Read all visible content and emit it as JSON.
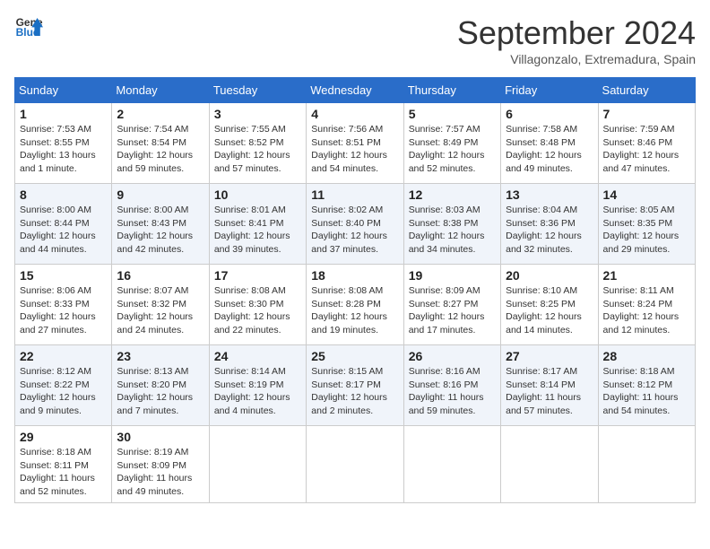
{
  "logo": {
    "line1": "General",
    "line2": "Blue"
  },
  "title": "September 2024",
  "location": "Villagonzalo, Extremadura, Spain",
  "headers": [
    "Sunday",
    "Monday",
    "Tuesday",
    "Wednesday",
    "Thursday",
    "Friday",
    "Saturday"
  ],
  "weeks": [
    [
      {
        "day": "1",
        "sunrise": "7:53 AM",
        "sunset": "8:55 PM",
        "daylight": "13 hours and 1 minute."
      },
      {
        "day": "2",
        "sunrise": "7:54 AM",
        "sunset": "8:54 PM",
        "daylight": "12 hours and 59 minutes."
      },
      {
        "day": "3",
        "sunrise": "7:55 AM",
        "sunset": "8:52 PM",
        "daylight": "12 hours and 57 minutes."
      },
      {
        "day": "4",
        "sunrise": "7:56 AM",
        "sunset": "8:51 PM",
        "daylight": "12 hours and 54 minutes."
      },
      {
        "day": "5",
        "sunrise": "7:57 AM",
        "sunset": "8:49 PM",
        "daylight": "12 hours and 52 minutes."
      },
      {
        "day": "6",
        "sunrise": "7:58 AM",
        "sunset": "8:48 PM",
        "daylight": "12 hours and 49 minutes."
      },
      {
        "day": "7",
        "sunrise": "7:59 AM",
        "sunset": "8:46 PM",
        "daylight": "12 hours and 47 minutes."
      }
    ],
    [
      {
        "day": "8",
        "sunrise": "8:00 AM",
        "sunset": "8:44 PM",
        "daylight": "12 hours and 44 minutes."
      },
      {
        "day": "9",
        "sunrise": "8:00 AM",
        "sunset": "8:43 PM",
        "daylight": "12 hours and 42 minutes."
      },
      {
        "day": "10",
        "sunrise": "8:01 AM",
        "sunset": "8:41 PM",
        "daylight": "12 hours and 39 minutes."
      },
      {
        "day": "11",
        "sunrise": "8:02 AM",
        "sunset": "8:40 PM",
        "daylight": "12 hours and 37 minutes."
      },
      {
        "day": "12",
        "sunrise": "8:03 AM",
        "sunset": "8:38 PM",
        "daylight": "12 hours and 34 minutes."
      },
      {
        "day": "13",
        "sunrise": "8:04 AM",
        "sunset": "8:36 PM",
        "daylight": "12 hours and 32 minutes."
      },
      {
        "day": "14",
        "sunrise": "8:05 AM",
        "sunset": "8:35 PM",
        "daylight": "12 hours and 29 minutes."
      }
    ],
    [
      {
        "day": "15",
        "sunrise": "8:06 AM",
        "sunset": "8:33 PM",
        "daylight": "12 hours and 27 minutes."
      },
      {
        "day": "16",
        "sunrise": "8:07 AM",
        "sunset": "8:32 PM",
        "daylight": "12 hours and 24 minutes."
      },
      {
        "day": "17",
        "sunrise": "8:08 AM",
        "sunset": "8:30 PM",
        "daylight": "12 hours and 22 minutes."
      },
      {
        "day": "18",
        "sunrise": "8:08 AM",
        "sunset": "8:28 PM",
        "daylight": "12 hours and 19 minutes."
      },
      {
        "day": "19",
        "sunrise": "8:09 AM",
        "sunset": "8:27 PM",
        "daylight": "12 hours and 17 minutes."
      },
      {
        "day": "20",
        "sunrise": "8:10 AM",
        "sunset": "8:25 PM",
        "daylight": "12 hours and 14 minutes."
      },
      {
        "day": "21",
        "sunrise": "8:11 AM",
        "sunset": "8:24 PM",
        "daylight": "12 hours and 12 minutes."
      }
    ],
    [
      {
        "day": "22",
        "sunrise": "8:12 AM",
        "sunset": "8:22 PM",
        "daylight": "12 hours and 9 minutes."
      },
      {
        "day": "23",
        "sunrise": "8:13 AM",
        "sunset": "8:20 PM",
        "daylight": "12 hours and 7 minutes."
      },
      {
        "day": "24",
        "sunrise": "8:14 AM",
        "sunset": "8:19 PM",
        "daylight": "12 hours and 4 minutes."
      },
      {
        "day": "25",
        "sunrise": "8:15 AM",
        "sunset": "8:17 PM",
        "daylight": "12 hours and 2 minutes."
      },
      {
        "day": "26",
        "sunrise": "8:16 AM",
        "sunset": "8:16 PM",
        "daylight": "11 hours and 59 minutes."
      },
      {
        "day": "27",
        "sunrise": "8:17 AM",
        "sunset": "8:14 PM",
        "daylight": "11 hours and 57 minutes."
      },
      {
        "day": "28",
        "sunrise": "8:18 AM",
        "sunset": "8:12 PM",
        "daylight": "11 hours and 54 minutes."
      }
    ],
    [
      {
        "day": "29",
        "sunrise": "8:18 AM",
        "sunset": "8:11 PM",
        "daylight": "11 hours and 52 minutes."
      },
      {
        "day": "30",
        "sunrise": "8:19 AM",
        "sunset": "8:09 PM",
        "daylight": "11 hours and 49 minutes."
      },
      null,
      null,
      null,
      null,
      null
    ]
  ]
}
